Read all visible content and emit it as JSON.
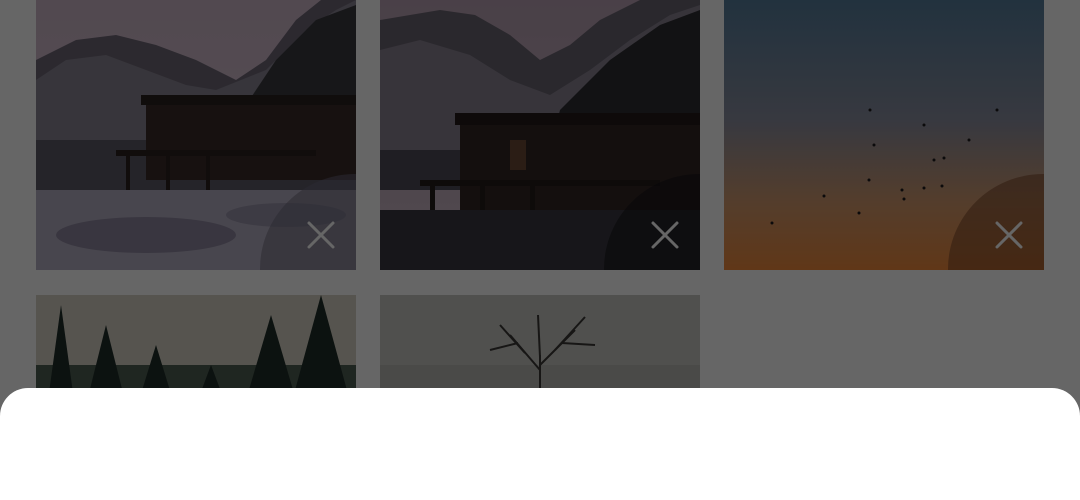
{
  "gallery": {
    "items": [
      {
        "photo": "lake-cabin-mountains-winter",
        "remove_icon": "close-icon"
      },
      {
        "photo": "lake-cabin-mountains-closeup",
        "remove_icon": "close-icon"
      },
      {
        "photo": "sunset-sky-birds",
        "remove_icon": "close-icon"
      },
      {
        "photo": "pine-forest"
      },
      {
        "photo": "bare-tree-fog"
      }
    ]
  },
  "overlay": {
    "scrim_color": "#000000",
    "scrim_opacity": 0.6
  },
  "bottom_sheet": {
    "background": "#ffffff"
  }
}
